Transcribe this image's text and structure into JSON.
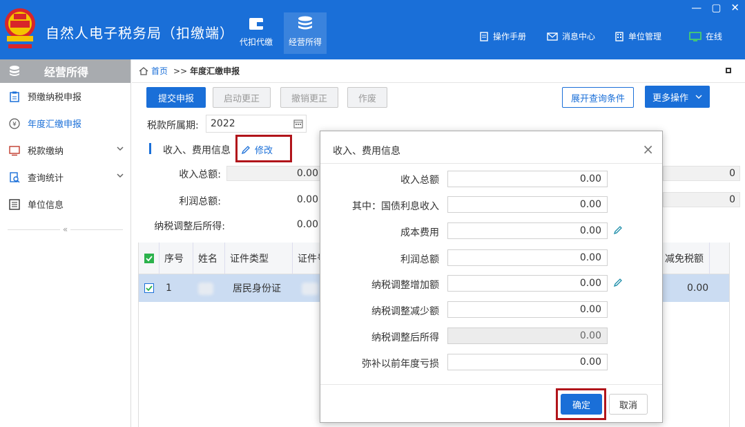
{
  "app": {
    "title": "自然人电子税务局（扣缴端）"
  },
  "nav": [
    {
      "label": "代扣代缴",
      "icon": "wallet-icon"
    },
    {
      "label": "经营所得",
      "icon": "coins-icon"
    }
  ],
  "tools": [
    {
      "label": "操作手册",
      "icon": "manual-icon"
    },
    {
      "label": "消息中心",
      "icon": "message-icon"
    },
    {
      "label": "单位管理",
      "icon": "building-icon"
    },
    {
      "label": "在线",
      "icon": "monitor-icon"
    }
  ],
  "window": {
    "minimize": "—",
    "maximize": "▢",
    "close": "✕"
  },
  "sidebar": {
    "header": "经营所得",
    "items": [
      {
        "label": "预缴纳税申报"
      },
      {
        "label": "年度汇缴申报"
      },
      {
        "label": "税款缴纳"
      },
      {
        "label": "查询统计"
      },
      {
        "label": "单位信息"
      }
    ],
    "collapse": "«"
  },
  "breadcrumb": {
    "home": "首页",
    "sep": ">>",
    "current": "年度汇缴申报"
  },
  "toolbar": {
    "submit": "提交申报",
    "start_correct": "启动更正",
    "cancel_correct": "撤销更正",
    "void": "作废",
    "expand_query": "展开查询条件",
    "more": "更多操作"
  },
  "period": {
    "label": "税款所属期:",
    "value": "2022"
  },
  "section": {
    "title": "收入、费用信息",
    "edit": "修改"
  },
  "summary": {
    "income_label": "收入总额:",
    "income_value": "0.00",
    "profit_label": "利润总额:",
    "profit_value": "0.00",
    "taxable_label": "纳税调整后所得:",
    "taxable_value": "0.00",
    "right_col_1": "0",
    "right_col_2": "0"
  },
  "table": {
    "headers": {
      "seq": "序号",
      "name": "姓名",
      "id_type": "证件类型",
      "id_no": "证件号",
      "reduction": "减免税额"
    },
    "rows": [
      {
        "seq": "1",
        "id_type": "居民身份证",
        "reduction": "0.00"
      }
    ]
  },
  "modal": {
    "title": "收入、费用信息",
    "close": "×",
    "fields": [
      {
        "label": "收入总额",
        "value": "0.00"
      },
      {
        "label": "其中：国债利息收入",
        "value": "0.00"
      },
      {
        "label": "成本费用",
        "value": "0.00"
      },
      {
        "label": "利润总额",
        "value": "0.00"
      },
      {
        "label": "纳税调整增加额",
        "value": "0.00"
      },
      {
        "label": "纳税调整减少额",
        "value": "0.00"
      },
      {
        "label": "纳税调整后所得",
        "value": "0.00"
      },
      {
        "label": "弥补以前年度亏损",
        "value": "0.00"
      }
    ],
    "ok": "确定",
    "cancel": "取消"
  },
  "colors": {
    "brand": "#1a6fd8",
    "highlight_border": "#b1141a",
    "row_selected": "#cbdcf2"
  }
}
